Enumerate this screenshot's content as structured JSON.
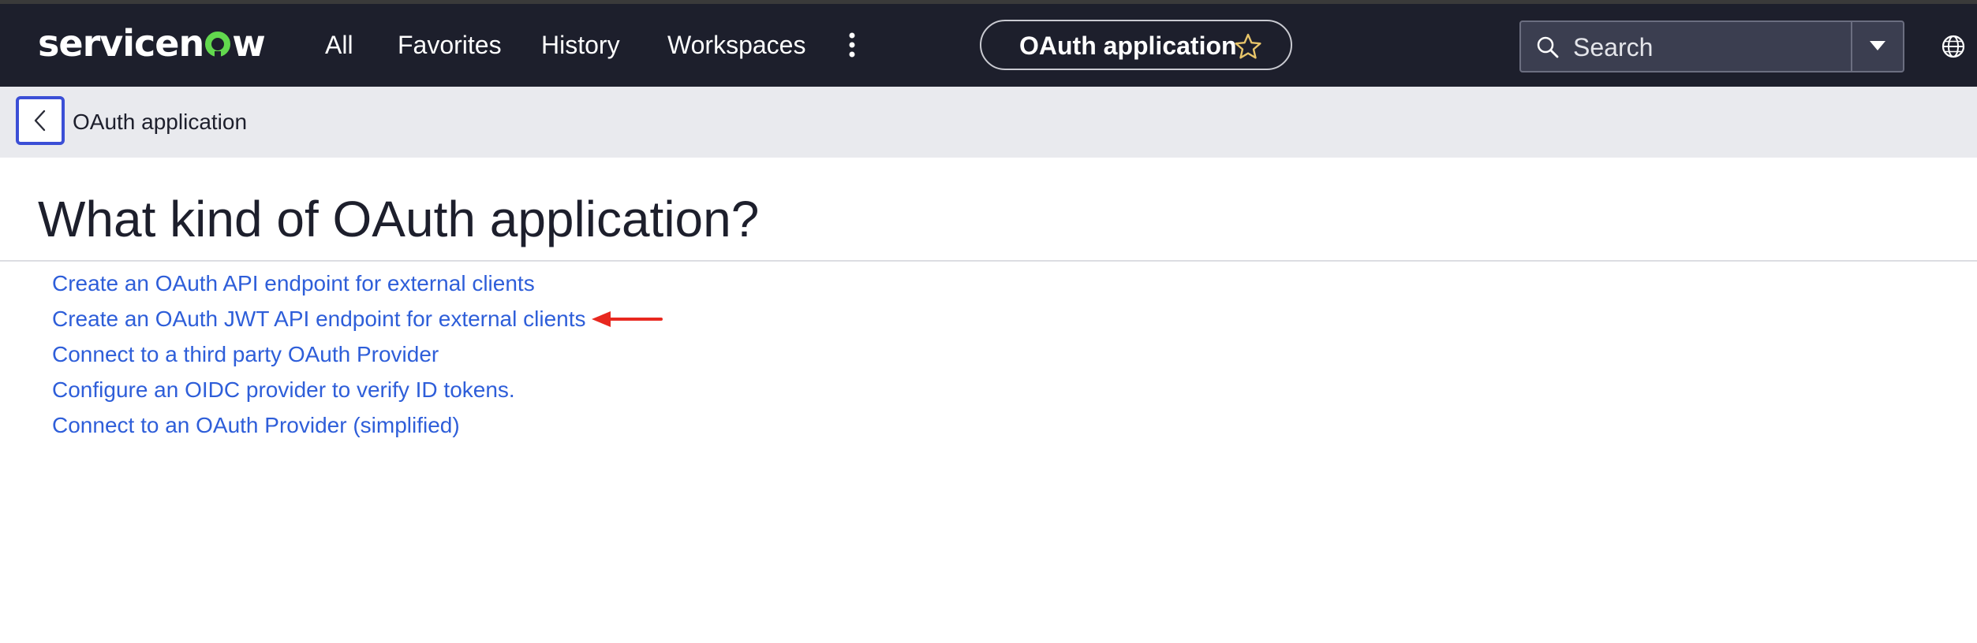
{
  "navbar": {
    "logo": {
      "before": "servicen",
      "after": "w"
    },
    "items": [
      "All",
      "Favorites",
      "History",
      "Workspaces"
    ],
    "more_icon": "vertical-ellipsis-icon",
    "current_app": "OAuth application",
    "favorite_icon": "star-icon",
    "search": {
      "placeholder": "Search",
      "icon": "search-icon",
      "dropdown_icon": "caret-down-icon"
    },
    "globe_icon": "globe-icon"
  },
  "subheader": {
    "back_icon": "chevron-left-icon",
    "title": "OAuth application"
  },
  "main": {
    "heading": "What kind of OAuth application?",
    "options": [
      "Create an OAuth API endpoint for external clients",
      "Create an OAuth JWT API endpoint for external clients",
      "Connect to a third party OAuth Provider",
      "Configure an OIDC provider to verify ID tokens.",
      "Connect to an OAuth Provider (simplified)"
    ],
    "annotation_icon": "red-arrow-icon"
  },
  "colors": {
    "navbar_bg": "#1d1f2c",
    "subheader_bg": "#e9eaee",
    "link": "#2e5ed9",
    "logo_accent": "#62d84e",
    "star": "#e8c56a",
    "focus": "#3b4fd6",
    "annotation": "#e8281f"
  }
}
